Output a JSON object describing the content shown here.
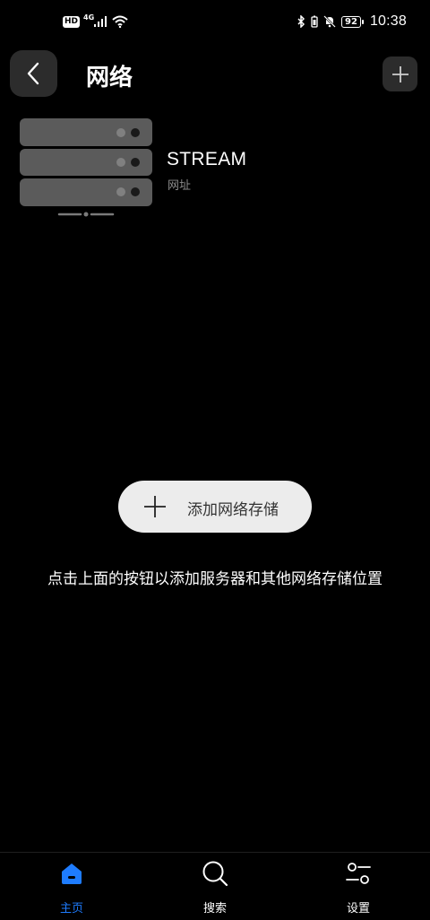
{
  "status_bar": {
    "hd": "HD",
    "network": "4G",
    "battery": "92",
    "time": "10:38"
  },
  "header": {
    "title": "网络"
  },
  "servers": [
    {
      "name": "STREAM",
      "subtitle": "网址"
    }
  ],
  "add_storage": {
    "label": "添加网络存储"
  },
  "hint": "点击上面的按钮以添加服务器和其他网络存储位置",
  "nav": {
    "items": [
      {
        "label": "主页",
        "icon": "home-icon",
        "active": true
      },
      {
        "label": "搜索",
        "icon": "search-icon",
        "active": false
      },
      {
        "label": "设置",
        "icon": "settings-icon",
        "active": false
      }
    ]
  },
  "colors": {
    "background": "#000000",
    "accent": "#1e7cff",
    "button_bg": "#2c2c2c",
    "pill_bg": "#ececec"
  }
}
